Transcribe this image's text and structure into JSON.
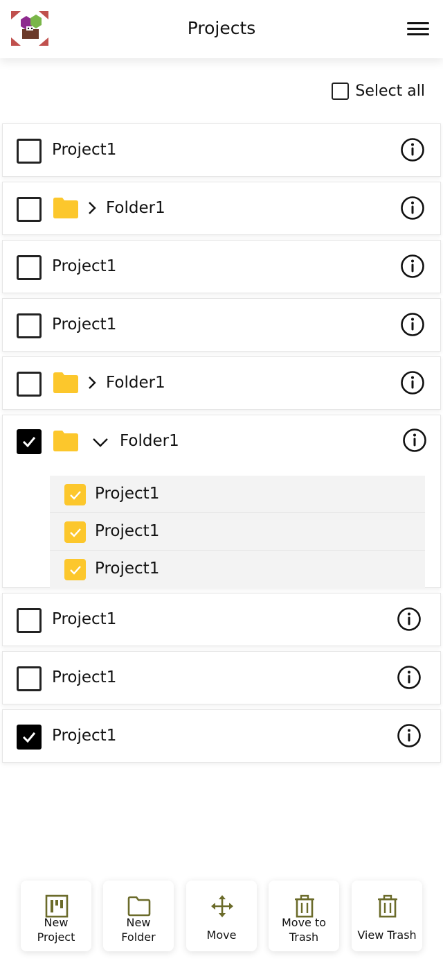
{
  "header": {
    "title": "Projects"
  },
  "select_all": {
    "label": "Select all",
    "checked": false
  },
  "rows": [
    {
      "type": "project",
      "label": "Project1",
      "checked": false
    },
    {
      "type": "folder",
      "label": "Folder1",
      "checked": false,
      "expanded": false
    },
    {
      "type": "project",
      "label": "Project1",
      "checked": false
    },
    {
      "type": "project",
      "label": "Project1",
      "checked": false
    },
    {
      "type": "folder",
      "label": "Folder1",
      "checked": false,
      "expanded": false
    },
    {
      "type": "folder",
      "label": "Folder1",
      "checked": true,
      "expanded": true,
      "children": [
        {
          "label": "Project1",
          "checked": true
        },
        {
          "label": "Project1",
          "checked": true
        },
        {
          "label": "Project1",
          "checked": true
        }
      ]
    },
    {
      "type": "project",
      "label": "Project1",
      "checked": false
    },
    {
      "type": "project",
      "label": "Project1",
      "checked": false
    },
    {
      "type": "project",
      "label": "Project1",
      "checked": true
    }
  ],
  "bottom_bar": {
    "new_project": {
      "line1": "New",
      "line2": "Project",
      "icon": "board-icon"
    },
    "new_folder": {
      "line1": "New",
      "line2": "Folder",
      "icon": "folder-outline-icon"
    },
    "move": {
      "label": "Move",
      "icon": "move-arrows-icon"
    },
    "move_to_trash": {
      "line1": "Move to",
      "line2": "Trash",
      "icon": "trash-icon"
    },
    "view_trash": {
      "label": "View Trash",
      "icon": "trash-icon"
    }
  },
  "colors": {
    "folder": "#fcc72c",
    "checked_child": "#fcc72c",
    "bottom_icon": "#6b6b2a",
    "checked_box": "#000000"
  }
}
